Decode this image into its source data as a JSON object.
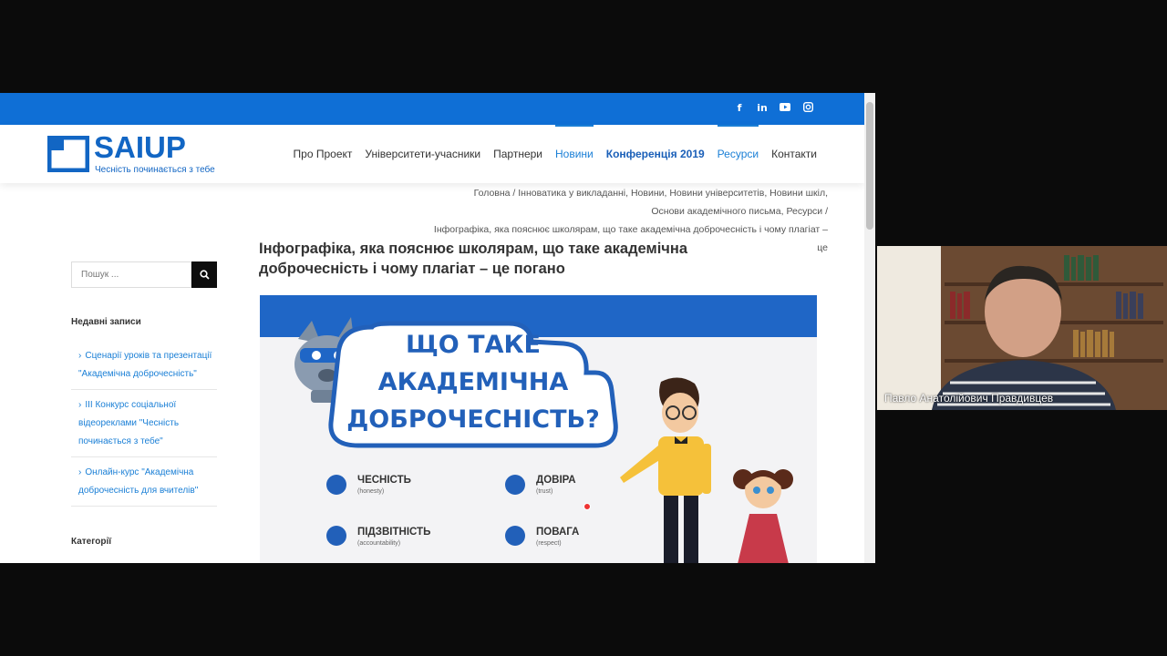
{
  "site": {
    "logo_title": "SAIUP",
    "logo_subtitle": "Чесність починається з тебе",
    "brand_color": "#0f6fd6"
  },
  "social": [
    "facebook-icon",
    "linkedin-icon",
    "youtube-icon",
    "instagram-icon"
  ],
  "nav": [
    {
      "label": "Про Проект",
      "state": "normal"
    },
    {
      "label": "Університети-учасники",
      "state": "normal"
    },
    {
      "label": "Партнери",
      "state": "normal"
    },
    {
      "label": "Новини",
      "state": "active"
    },
    {
      "label": "Конференція 2019",
      "state": "bold"
    },
    {
      "label": "Ресурси",
      "state": "active"
    },
    {
      "label": "Контакти",
      "state": "normal"
    }
  ],
  "breadcrumb": {
    "line1": "Головна / Інноватика у викладанні, Новини, Новини університетів, Новини шкіл,",
    "line2": "Основи академічного письма, Ресурси /",
    "line3": "Інфографіка, яка пояснює школярам, що таке академічна доброчесність і чому плагіат – це"
  },
  "sidebar": {
    "search_placeholder": "Пошук ...",
    "recent_title": "Недавні записи",
    "recent": [
      "Сценарії уроків та презентації \"Академічна доброчесність\"",
      "ІІІ Конкурс соціальної відеореклами \"Чесність починається з тебе\"",
      "Онлайн-курс \"Академічна доброчесність для вчителів\""
    ],
    "categories_title": "Категорії"
  },
  "article": {
    "title": "Інфографіка, яка пояснює школярам, що таке академічна доброчесність і чому плагіат – це погано"
  },
  "infographic": {
    "line1": "ЩО ТАКЕ",
    "line2": "АКАДЕМІЧНА",
    "line3": "ДОБРОЧЕСНІСТЬ?",
    "values": [
      {
        "label": "ЧЕСНІСТЬ",
        "sub": "(honesty)"
      },
      {
        "label": "ДОВІРА",
        "sub": "(trust)"
      },
      {
        "label": "ПІДЗВІТНІСТЬ",
        "sub": "(accountability)"
      },
      {
        "label": "ПОВАГА",
        "sub": "(respect)"
      }
    ]
  },
  "webcam": {
    "participant_name": "Павло Анатолійович Правдивцев"
  }
}
